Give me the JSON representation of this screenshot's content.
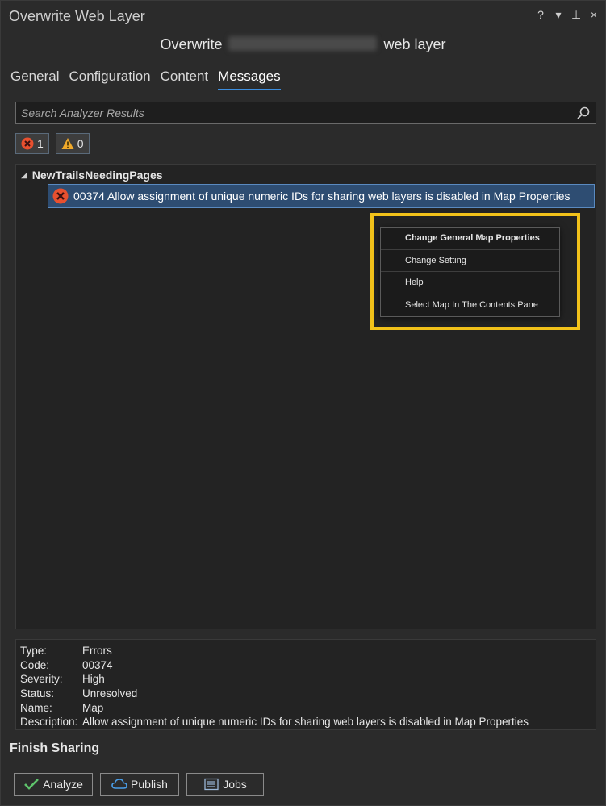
{
  "window": {
    "title": "Overwrite Web Layer",
    "icons": {
      "help": "?",
      "menu": "▾",
      "pin": "⊥",
      "close": "×"
    }
  },
  "heading": {
    "prefix": "Overwrite",
    "suffix": "web layer"
  },
  "tabs": [
    {
      "label": "General",
      "active": false
    },
    {
      "label": "Configuration",
      "active": false
    },
    {
      "label": "Content",
      "active": false
    },
    {
      "label": "Messages",
      "active": true
    }
  ],
  "search": {
    "placeholder": "Search Analyzer Results",
    "value": ""
  },
  "filters": {
    "errors_count": "1",
    "warnings_count": "0"
  },
  "results": {
    "group_name": "NewTrailsNeedingPages",
    "message": "00374 Allow assignment of unique numeric IDs for sharing web layers is disabled in Map Properties"
  },
  "context_menu": {
    "items": [
      "Change General Map Properties",
      "Change Setting",
      "Help",
      "Select Map In The Contents Pane"
    ]
  },
  "details": {
    "rows": [
      {
        "key": "Type:",
        "value": "Errors"
      },
      {
        "key": "Code:",
        "value": "00374"
      },
      {
        "key": "Severity:",
        "value": "High"
      },
      {
        "key": "Status:",
        "value": "Unresolved"
      },
      {
        "key": "Name:",
        "value": "Map"
      },
      {
        "key": "Description:",
        "value": "Allow assignment of unique numeric IDs for sharing web layers is disabled in Map Properties"
      }
    ]
  },
  "finish": {
    "title": "Finish Sharing",
    "analyze_label": "Analyze",
    "publish_label": "Publish",
    "jobs_label": "Jobs"
  },
  "colors": {
    "accent": "#3d8fe0",
    "selection": "#2e4d72",
    "highlight": "#f2c21a",
    "error": "#e8502f",
    "warning": "#f0a92a",
    "check": "#5ec36b"
  }
}
